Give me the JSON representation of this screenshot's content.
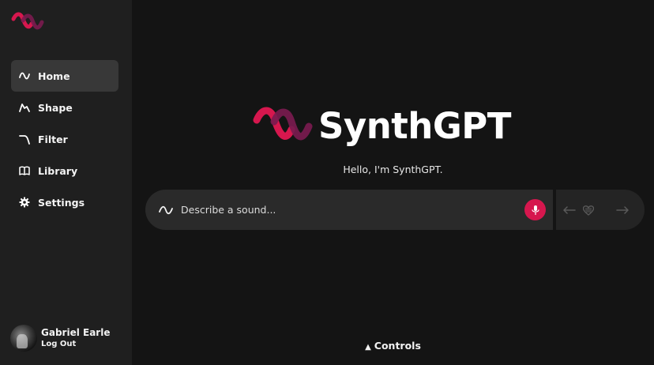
{
  "sidebar": {
    "logo_icon": "synth-wave-logo",
    "items": [
      {
        "label": "Home",
        "icon": "wave-icon",
        "active": true
      },
      {
        "label": "Shape",
        "icon": "envelope-shape-icon",
        "active": false
      },
      {
        "label": "Filter",
        "icon": "filter-curve-icon",
        "active": false
      },
      {
        "label": "Library",
        "icon": "book-icon",
        "active": false
      },
      {
        "label": "Settings",
        "icon": "gear-icon",
        "active": false
      }
    ],
    "user": {
      "name": "Gabriel Earle",
      "logout_label": "Log Out"
    }
  },
  "main": {
    "brand_name": "SynthGPT",
    "greeting": "Hello, I'm SynthGPT.",
    "prompt": {
      "placeholder": "Describe a sound...",
      "value": ""
    },
    "controls_label": "Controls"
  },
  "colors": {
    "accent": "#d6174e",
    "accent_dark": "#7a1b4f",
    "background": "#141414",
    "sidebar": "#1f1f1f"
  }
}
